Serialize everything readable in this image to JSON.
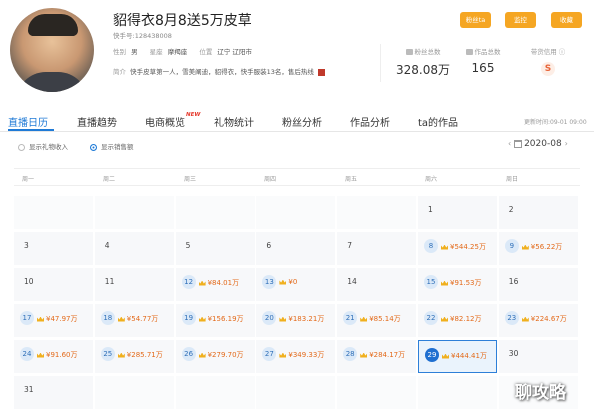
{
  "profile": {
    "name": "貂得衣8月8送5万皮草",
    "kuaishou_id": "快手号:128438008",
    "gender_label": "性别",
    "gender": "男",
    "zodiac_label": "星座",
    "zodiac": "摩羯座",
    "location_label": "位置",
    "location": "辽宁 辽阳市",
    "intro_label": "简介",
    "intro": "快手皮草第一人，雪美阐迪，貂得衣，快手服装13名，售后热线"
  },
  "actions": {
    "fans_label": "粉丝ta",
    "monitor_label": "监控",
    "collect_label": "收藏"
  },
  "stats": {
    "fans_label": "粉丝总数",
    "fans_value": "328.08万",
    "works_label": "作品总数",
    "works_value": "165",
    "cred_label": "带货信用",
    "cred_value": "S"
  },
  "tabs": [
    {
      "label": "直播日历"
    },
    {
      "label": "直播趋势"
    },
    {
      "label": "电商概览"
    },
    {
      "label": "礼物统计"
    },
    {
      "label": "粉丝分析"
    },
    {
      "label": "作品分析"
    },
    {
      "label": "ta的作品"
    }
  ],
  "new_badge": "NEW",
  "update_time": "更新时间:09-01 09:00",
  "filters": {
    "gift_income": "显示礼物收入",
    "sales": "显示销售额"
  },
  "month": "2020-08",
  "weekdays": [
    "周一",
    "周二",
    "周三",
    "周四",
    "周五",
    "周六",
    "周日"
  ],
  "calendar": {
    "rows": [
      [
        {
          "day": ""
        },
        {
          "day": ""
        },
        {
          "day": ""
        },
        {
          "day": ""
        },
        {
          "day": ""
        },
        {
          "day": "1"
        },
        {
          "day": "2"
        }
      ],
      [
        {
          "day": "3"
        },
        {
          "day": "4"
        },
        {
          "day": "5"
        },
        {
          "day": "6"
        },
        {
          "day": "7"
        },
        {
          "day": "8",
          "amount": "¥544.25万"
        },
        {
          "day": "9",
          "amount": "¥56.22万"
        }
      ],
      [
        {
          "day": "10"
        },
        {
          "day": "11"
        },
        {
          "day": "12",
          "amount": "¥84.01万"
        },
        {
          "day": "13",
          "amount": "¥0"
        },
        {
          "day": "14"
        },
        {
          "day": "15",
          "amount": "¥91.53万"
        },
        {
          "day": "16"
        }
      ],
      [
        {
          "day": "17",
          "amount": "¥47.97万"
        },
        {
          "day": "18",
          "amount": "¥54.77万"
        },
        {
          "day": "19",
          "amount": "¥156.19万"
        },
        {
          "day": "20",
          "amount": "¥183.21万"
        },
        {
          "day": "21",
          "amount": "¥85.14万"
        },
        {
          "day": "22",
          "amount": "¥82.12万"
        },
        {
          "day": "23",
          "amount": "¥224.67万"
        }
      ],
      [
        {
          "day": "24",
          "amount": "¥91.60万"
        },
        {
          "day": "25",
          "amount": "¥285.71万"
        },
        {
          "day": "26",
          "amount": "¥279.70万"
        },
        {
          "day": "27",
          "amount": "¥349.33万"
        },
        {
          "day": "28",
          "amount": "¥284.17万"
        },
        {
          "day": "29",
          "amount": "¥444.41万",
          "selected": true
        },
        {
          "day": "30"
        }
      ],
      [
        {
          "day": "31"
        },
        {
          "day": ""
        },
        {
          "day": ""
        },
        {
          "day": ""
        },
        {
          "day": ""
        },
        {
          "day": ""
        },
        {
          "day": ""
        }
      ]
    ]
  },
  "watermark": "聊攻略"
}
